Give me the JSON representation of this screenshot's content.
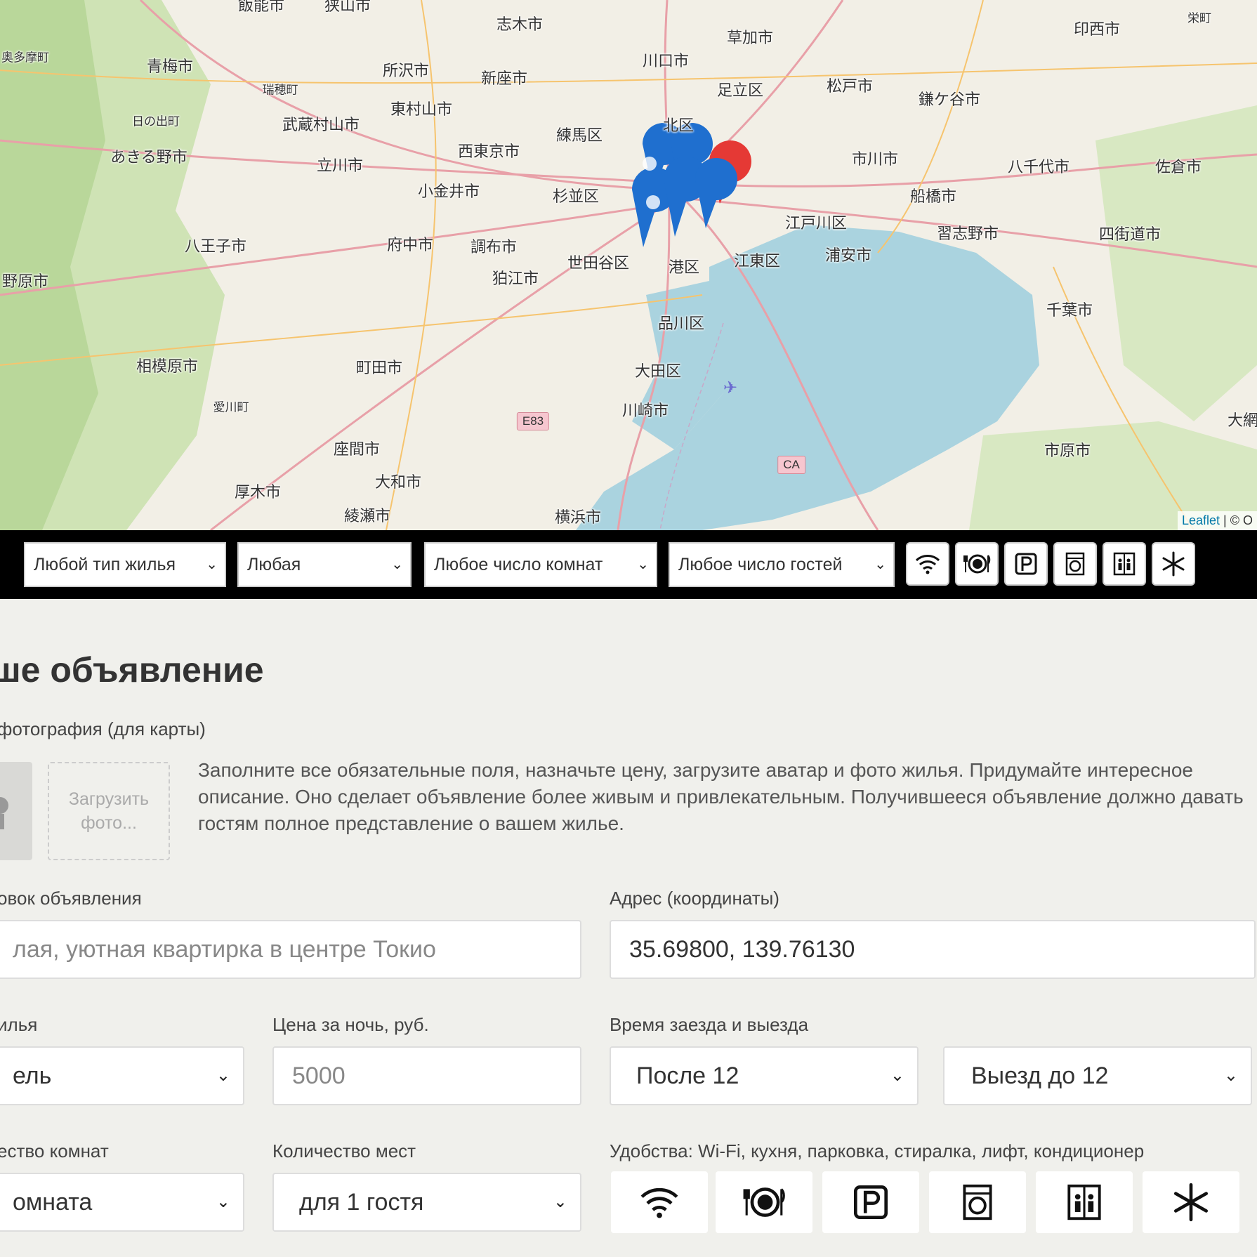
{
  "map": {
    "labels": [
      {
        "text": "飯能市",
        "size": "normal"
      },
      {
        "text": "狭山市",
        "size": "normal"
      },
      {
        "text": "志木市",
        "size": "normal"
      },
      {
        "text": "草加市",
        "size": "normal"
      },
      {
        "text": "印西市",
        "size": "normal"
      },
      {
        "text": "栄町",
        "size": "small"
      },
      {
        "text": "奥多摩町",
        "size": "small"
      },
      {
        "text": "青梅市",
        "size": "normal"
      },
      {
        "text": "所沢市",
        "size": "normal"
      },
      {
        "text": "新座市",
        "size": "normal"
      },
      {
        "text": "川口市",
        "size": "normal"
      },
      {
        "text": "足立区",
        "size": "normal"
      },
      {
        "text": "松戸市",
        "size": "normal"
      },
      {
        "text": "鎌ケ谷市",
        "size": "normal"
      },
      {
        "text": "瑞穂町",
        "size": "small"
      },
      {
        "text": "東村山市",
        "size": "normal"
      },
      {
        "text": "日の出町",
        "size": "small"
      },
      {
        "text": "武蔵村山市",
        "size": "normal"
      },
      {
        "text": "北区",
        "size": "normal"
      },
      {
        "text": "練馬区",
        "size": "normal"
      },
      {
        "text": "あきる野市",
        "size": "normal"
      },
      {
        "text": "西東京市",
        "size": "normal"
      },
      {
        "text": "立川市",
        "size": "normal"
      },
      {
        "text": "市川市",
        "size": "normal"
      },
      {
        "text": "八千代市",
        "size": "normal"
      },
      {
        "text": "佐倉市",
        "size": "normal"
      },
      {
        "text": "小金井市",
        "size": "normal"
      },
      {
        "text": "杉並区",
        "size": "normal"
      },
      {
        "text": "船橋市",
        "size": "normal"
      },
      {
        "text": "江戸川区",
        "size": "normal"
      },
      {
        "text": "八王子市",
        "size": "normal"
      },
      {
        "text": "府中市",
        "size": "normal"
      },
      {
        "text": "調布市",
        "size": "normal"
      },
      {
        "text": "習志野市",
        "size": "normal"
      },
      {
        "text": "四街道市",
        "size": "normal"
      },
      {
        "text": "浦安市",
        "size": "normal"
      },
      {
        "text": "世田谷区",
        "size": "normal"
      },
      {
        "text": "港区",
        "size": "normal"
      },
      {
        "text": "江東区",
        "size": "normal"
      },
      {
        "text": "野原市",
        "size": "normal"
      },
      {
        "text": "狛江市",
        "size": "normal"
      },
      {
        "text": "千葉市",
        "size": "normal"
      },
      {
        "text": "品川区",
        "size": "normal"
      },
      {
        "text": "相模原市",
        "size": "normal"
      },
      {
        "text": "町田市",
        "size": "normal"
      },
      {
        "text": "大田区",
        "size": "normal"
      },
      {
        "text": "愛川町",
        "size": "small"
      },
      {
        "text": "川崎市",
        "size": "normal"
      },
      {
        "text": "大網",
        "size": "normal"
      },
      {
        "text": "市原市",
        "size": "normal"
      },
      {
        "text": "座間市",
        "size": "normal"
      },
      {
        "text": "大和市",
        "size": "normal"
      },
      {
        "text": "厚木市",
        "size": "normal"
      },
      {
        "text": "綾瀬市",
        "size": "normal"
      },
      {
        "text": "横浜市",
        "size": "normal"
      }
    ],
    "shields": [
      "E83",
      "CA"
    ],
    "attribution": {
      "link": "Leaflet",
      "rest": " | © O"
    }
  },
  "filters": {
    "type": "Любой тип жилья",
    "price": "Любая",
    "rooms": "Любое число комнат",
    "guests": "Любое число гостей",
    "features": [
      "wifi-icon",
      "kitchen-icon",
      "parking-icon",
      "washer-icon",
      "elevator-icon",
      "conditioner-icon"
    ]
  },
  "form": {
    "title": "ше объявление",
    "avatar_label": "фотография (для карты)",
    "upload_label": "Загрузить фото...",
    "hint": "Заполните все обязательные поля, назначьте цену, загрузите аватар и фото жилья. Придумайте интересное описание. Оно сделает объявление более живым и привлекательным. Получившееся объявление должно давать гостям полное представление о вашем жилье.",
    "title_label": "овок объявления",
    "title_placeholder": "лая, уютная квартирка в центре Токио",
    "address_label": "Адрес (координаты)",
    "address_value": "35.69800, 139.76130",
    "type_label": "илья",
    "type_value": "ель",
    "price_label": "Цена за ночь, руб.",
    "price_placeholder": "5000",
    "time_label": "Время заезда и выезда",
    "checkin_value": "После 12",
    "checkout_value": "Выезд до 12",
    "rooms_label": "ество комнат",
    "rooms_value": "омната",
    "capacity_label": "Количество мест",
    "capacity_value": "для 1 гостя",
    "features_label": "Удобства: Wi-Fi, кухня, парковка, стиралка, лифт, кондиционер"
  }
}
